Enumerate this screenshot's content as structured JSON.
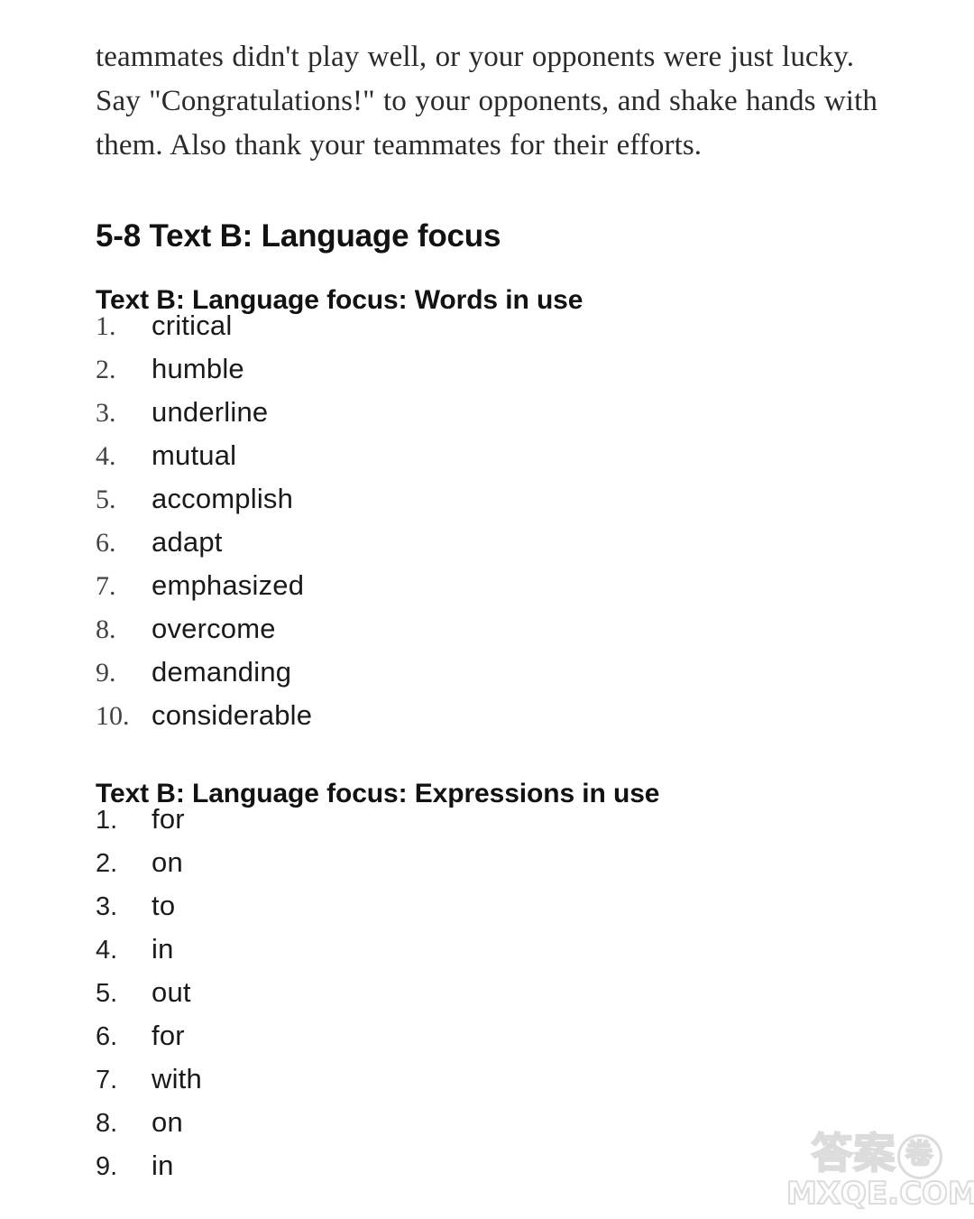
{
  "document": {
    "intro_paragraph": "teammates didn't play well, or your opponents were just lucky. Say \"Congratulations!\" to your opponents, and shake hands with them. Also thank your teammates for their efforts.",
    "main_heading": "5-8 Text B: Language focus",
    "sections": [
      {
        "heading": "Text B: Language focus: Words in use",
        "numeral_style": "serif",
        "items": [
          {
            "number": "1.",
            "answer": "critical"
          },
          {
            "number": "2.",
            "answer": "humble"
          },
          {
            "number": "3.",
            "answer": "underline"
          },
          {
            "number": "4.",
            "answer": "mutual"
          },
          {
            "number": "5.",
            "answer": "accomplish"
          },
          {
            "number": "6.",
            "answer": "adapt"
          },
          {
            "number": "7.",
            "answer": "emphasized"
          },
          {
            "number": "8.",
            "answer": "overcome"
          },
          {
            "number": "9.",
            "answer": "demanding"
          },
          {
            "number": "10.",
            "answer": "considerable"
          }
        ]
      },
      {
        "heading": "Text B: Language focus: Expressions in use",
        "numeral_style": "sans",
        "items": [
          {
            "number": "1.",
            "answer": "for"
          },
          {
            "number": "2.",
            "answer": "on"
          },
          {
            "number": "3.",
            "answer": "to"
          },
          {
            "number": "4.",
            "answer": "in"
          },
          {
            "number": "5.",
            "answer": "out"
          },
          {
            "number": "6.",
            "answer": "for"
          },
          {
            "number": "7.",
            "answer": "with"
          },
          {
            "number": "8.",
            "answer": "on"
          },
          {
            "number": "9.",
            "answer": "in"
          }
        ]
      }
    ]
  },
  "watermark": {
    "chinese_text": "答案",
    "chinese_circled": "卷",
    "url_text": "MXQE.COM",
    "color": "#dcdcdc"
  },
  "colors": {
    "background": "#ffffff",
    "body_text": "#1a1a1a",
    "serif_text": "#2a2a2a",
    "heading_text": "#121212",
    "numeral_serif": "#434343"
  }
}
